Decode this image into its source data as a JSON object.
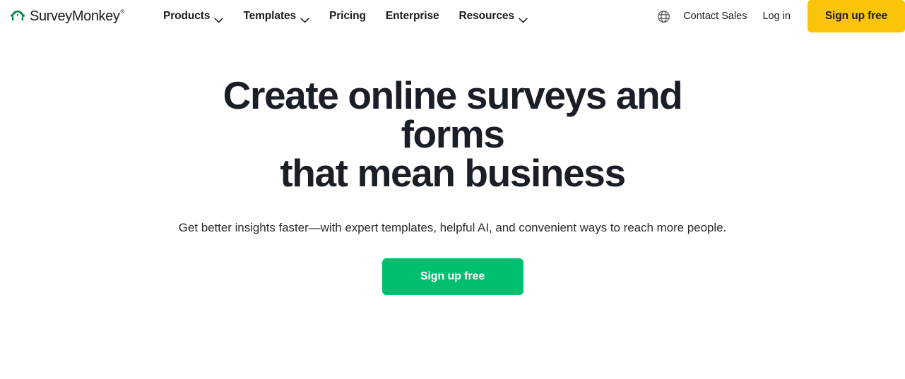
{
  "brand": {
    "name": "SurveyMonkey",
    "trademark": "®",
    "logo_icon": "surveymonkey-logo-icon",
    "logo_color": "#00824a"
  },
  "nav": {
    "items": [
      {
        "label": "Products",
        "has_dropdown": true,
        "icon": "chevron-down-icon"
      },
      {
        "label": "Templates",
        "has_dropdown": true,
        "icon": "chevron-down-icon"
      },
      {
        "label": "Pricing",
        "has_dropdown": false,
        "icon": ""
      },
      {
        "label": "Enterprise",
        "has_dropdown": false,
        "icon": ""
      },
      {
        "label": "Resources",
        "has_dropdown": true,
        "icon": "chevron-down-icon"
      }
    ],
    "language_icon": "globe-icon",
    "contact_sales_label": "Contact Sales",
    "login_label": "Log in",
    "signup_label": "Sign up free",
    "signup_color": "#f9c40a"
  },
  "hero": {
    "title_line1": "Create online surveys and forms",
    "title_line2": "that mean business",
    "subtitle": "Get better insights faster—with expert templates, helpful AI, and convenient ways to reach more people.",
    "cta_label": "Sign up free",
    "cta_color": "#00bf6f"
  }
}
